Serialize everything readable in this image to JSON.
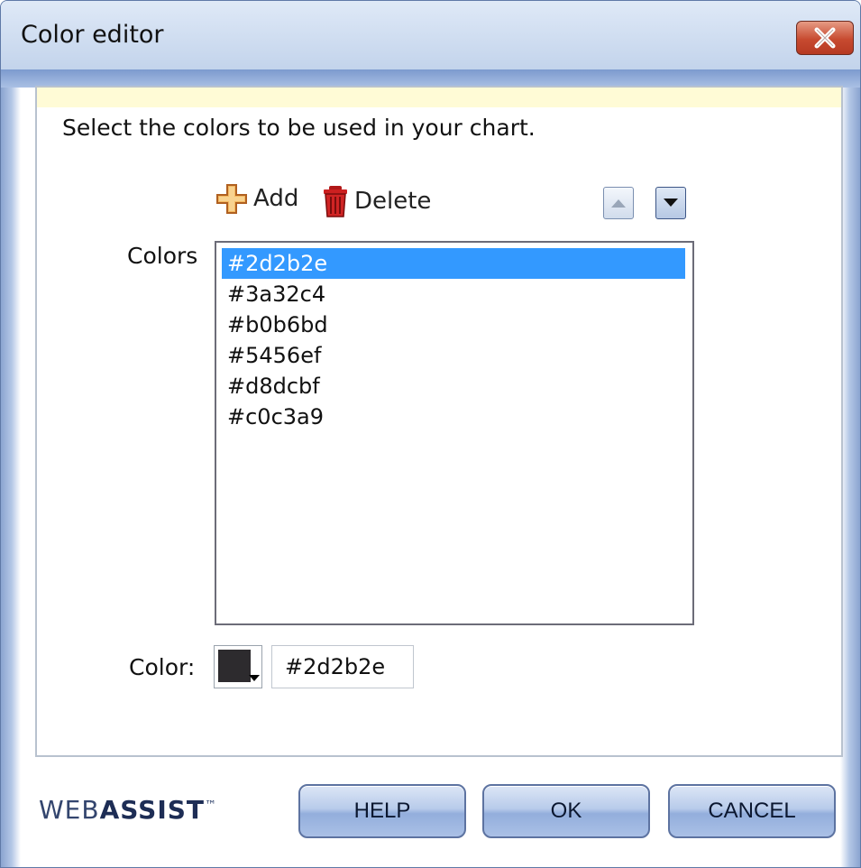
{
  "window": {
    "title": "Color editor",
    "close_icon": "close-x-icon"
  },
  "panel": {
    "instruction": "Select the colors to be used in your chart."
  },
  "toolbar": {
    "add_label": "Add",
    "delete_label": "Delete",
    "add_icon": "plus-icon",
    "delete_icon": "trash-icon",
    "move_up_icon": "arrow-up-icon",
    "move_down_icon": "arrow-down-icon"
  },
  "colors_list": {
    "label": "Colors",
    "items": [
      "#2d2b2e",
      "#3a32c4",
      "#b0b6bd",
      "#5456ef",
      "#d8dcbf",
      "#c0c3a9"
    ],
    "selected_index": 0
  },
  "color_field": {
    "label": "Color:",
    "value": "#2d2b2e",
    "swatch_color": "#2d2b2e"
  },
  "footer": {
    "brand_prefix": "WEB",
    "brand_bold": "ASSIST",
    "brand_tm": "™",
    "help_label": "HELP",
    "ok_label": "OK",
    "cancel_label": "CANCEL"
  },
  "theme": {
    "selection_color": "#3399ff",
    "panel_strip_color": "#fffbd6"
  }
}
